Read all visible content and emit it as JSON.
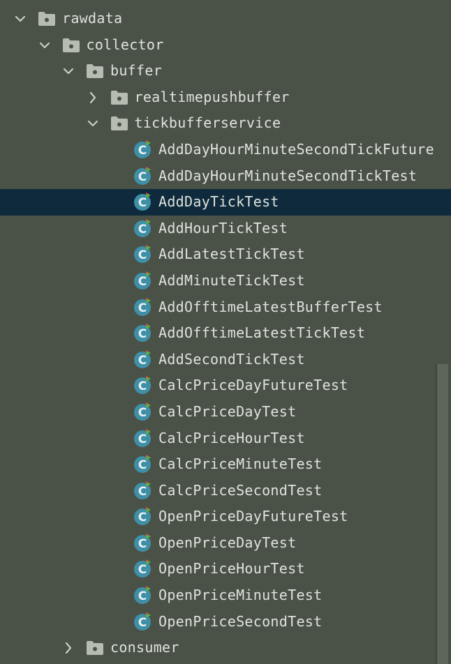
{
  "tree": [
    {
      "label": "rawdata",
      "kind": "folder",
      "depth": 0,
      "expanded": true,
      "selected": false
    },
    {
      "label": "collector",
      "kind": "folder",
      "depth": 1,
      "expanded": true,
      "selected": false
    },
    {
      "label": "buffer",
      "kind": "folder",
      "depth": 2,
      "expanded": true,
      "selected": false
    },
    {
      "label": "realtimepushbuffer",
      "kind": "folder",
      "depth": 3,
      "expanded": false,
      "selected": false
    },
    {
      "label": "tickbufferservice",
      "kind": "folder",
      "depth": 3,
      "expanded": true,
      "selected": false
    },
    {
      "label": "AddDayHourMinuteSecondTickFuture",
      "kind": "test-class",
      "depth": 4,
      "selected": false
    },
    {
      "label": "AddDayHourMinuteSecondTickTest",
      "kind": "test-class",
      "depth": 4,
      "selected": false
    },
    {
      "label": "AddDayTickTest",
      "kind": "test-class",
      "depth": 4,
      "selected": true
    },
    {
      "label": "AddHourTickTest",
      "kind": "test-class",
      "depth": 4,
      "selected": false
    },
    {
      "label": "AddLatestTickTest",
      "kind": "test-class",
      "depth": 4,
      "selected": false
    },
    {
      "label": "AddMinuteTickTest",
      "kind": "test-class",
      "depth": 4,
      "selected": false
    },
    {
      "label": "AddOfftimeLatestBufferTest",
      "kind": "test-class",
      "depth": 4,
      "selected": false
    },
    {
      "label": "AddOfftimeLatestTickTest",
      "kind": "test-class",
      "depth": 4,
      "selected": false
    },
    {
      "label": "AddSecondTickTest",
      "kind": "test-class",
      "depth": 4,
      "selected": false
    },
    {
      "label": "CalcPriceDayFutureTest",
      "kind": "test-class",
      "depth": 4,
      "selected": false
    },
    {
      "label": "CalcPriceDayTest",
      "kind": "test-class",
      "depth": 4,
      "selected": false
    },
    {
      "label": "CalcPriceHourTest",
      "kind": "test-class",
      "depth": 4,
      "selected": false
    },
    {
      "label": "CalcPriceMinuteTest",
      "kind": "test-class",
      "depth": 4,
      "selected": false
    },
    {
      "label": "CalcPriceSecondTest",
      "kind": "test-class",
      "depth": 4,
      "selected": false
    },
    {
      "label": "OpenPriceDayFutureTest",
      "kind": "test-class",
      "depth": 4,
      "selected": false
    },
    {
      "label": "OpenPriceDayTest",
      "kind": "test-class",
      "depth": 4,
      "selected": false
    },
    {
      "label": "OpenPriceHourTest",
      "kind": "test-class",
      "depth": 4,
      "selected": false
    },
    {
      "label": "OpenPriceMinuteTest",
      "kind": "test-class",
      "depth": 4,
      "selected": false
    },
    {
      "label": "OpenPriceSecondTest",
      "kind": "test-class",
      "depth": 4,
      "selected": false
    },
    {
      "label": "consumer",
      "kind": "folder",
      "depth": 2,
      "expanded": false,
      "selected": false
    }
  ],
  "colors": {
    "background": "#4a5247",
    "text": "#dfe3dc",
    "selected_row": "#0e2a3c",
    "folder_icon": "#b7bcb3",
    "class_icon": "#3f8fa6",
    "test_badge_green": "#55b24a",
    "test_badge_red": "#e0513e",
    "chevron": "#c9cec5"
  },
  "icons": {
    "folder": "folder-icon",
    "test-class": "test-class-icon",
    "expanded": "chevron-down-icon",
    "collapsed": "chevron-right-icon"
  }
}
